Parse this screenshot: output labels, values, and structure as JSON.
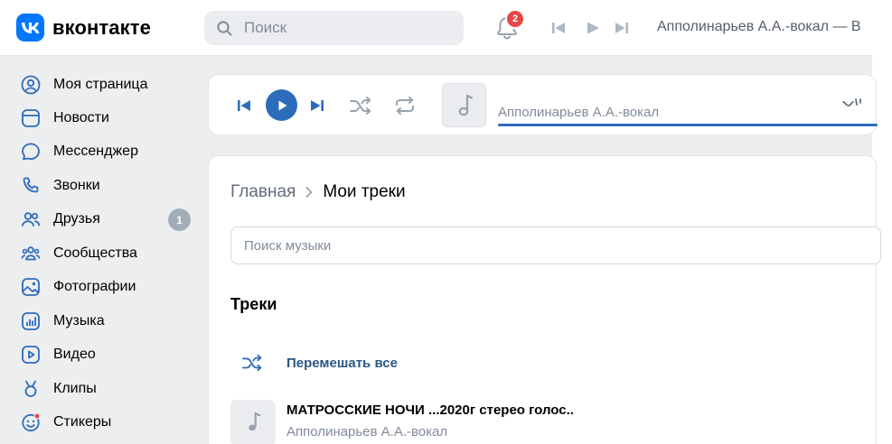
{
  "header": {
    "logo_text": "вконтакте",
    "search_placeholder": "Поиск",
    "notifications_count": "2",
    "now_playing": "Апполинарьев А.А.-вокал — В"
  },
  "sidebar": {
    "items": [
      {
        "label": "Моя страница",
        "icon": "profile-icon"
      },
      {
        "label": "Новости",
        "icon": "news-icon"
      },
      {
        "label": "Мессенджер",
        "icon": "messenger-icon"
      },
      {
        "label": "Звонки",
        "icon": "phone-icon"
      },
      {
        "label": "Друзья",
        "icon": "friends-icon",
        "badge": "1"
      },
      {
        "label": "Сообщества",
        "icon": "communities-icon"
      },
      {
        "label": "Фотографии",
        "icon": "photos-icon"
      },
      {
        "label": "Музыка",
        "icon": "music-icon"
      },
      {
        "label": "Видео",
        "icon": "video-icon"
      },
      {
        "label": "Клипы",
        "icon": "clips-icon"
      },
      {
        "label": "Стикеры",
        "icon": "stickers-icon"
      }
    ]
  },
  "player": {
    "artist": "Апполинарьев А.А.-вокал"
  },
  "main": {
    "breadcrumb_home": "Главная",
    "breadcrumb_current": "Мои треки",
    "search_placeholder": "Поиск музыки",
    "section_title": "Треки",
    "shuffle_label": "Перемешать все",
    "tracks": [
      {
        "title": "МАТРОССКИЕ НОЧИ ...2020г стерео голос..",
        "artist": "Апполинарьев А.А.-вокал"
      }
    ]
  },
  "colors": {
    "brand": "#0077ff",
    "accent": "#2d6cbb",
    "badge_red": "#e64646",
    "link": "#2a5885"
  }
}
